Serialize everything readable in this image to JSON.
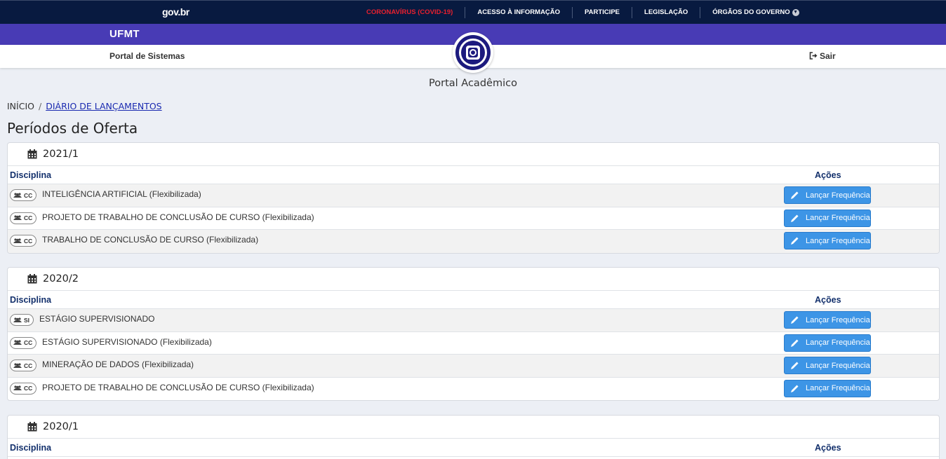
{
  "gov": {
    "logo": "gov.br",
    "links": [
      "CORONAVÍRUS (COVID-19)",
      "ACESSO À INFORMAÇÃO",
      "PARTICIPE",
      "LEGISLAÇÃO",
      "ÓRGÃOS DO GOVERNO"
    ],
    "covid_color": "#e8202e"
  },
  "header": {
    "org": "UFMT",
    "systems": "Portal de Sistemas",
    "logout": "Sair",
    "portal": "Portal Acadêmico",
    "brand_color": "#483bb5"
  },
  "breadcrumb": {
    "home": "INÍCIO",
    "separator": "/",
    "current": "DIÁRIO DE LANÇAMENTOS"
  },
  "page_title": "Períodos de Oferta",
  "table": {
    "col_discipline": "Disciplina",
    "col_actions": "Ações",
    "action_label": "Lançar Frequência"
  },
  "periods": [
    {
      "name": "2021/1",
      "rows": [
        {
          "badge": "CC",
          "name": "INTELIGÊNCIA ARTIFICIAL (Flexibilizada)"
        },
        {
          "badge": "CC",
          "name": "PROJETO DE TRABALHO DE CONCLUSÃO DE CURSO (Flexibilizada)"
        },
        {
          "badge": "CC",
          "name": "TRABALHO DE CONCLUSÃO DE CURSO (Flexibilizada)"
        }
      ]
    },
    {
      "name": "2020/2",
      "rows": [
        {
          "badge": "SI",
          "name": "ESTÁGIO SUPERVISIONADO"
        },
        {
          "badge": "CC",
          "name": "ESTÁGIO SUPERVISIONADO (Flexibilizada)"
        },
        {
          "badge": "CC",
          "name": "MINERAÇÃO DE DADOS (Flexibilizada)"
        },
        {
          "badge": "CC",
          "name": "PROJETO DE TRABALHO DE CONCLUSÃO DE CURSO (Flexibilizada)"
        }
      ]
    },
    {
      "name": "2020/1",
      "rows": []
    }
  ]
}
